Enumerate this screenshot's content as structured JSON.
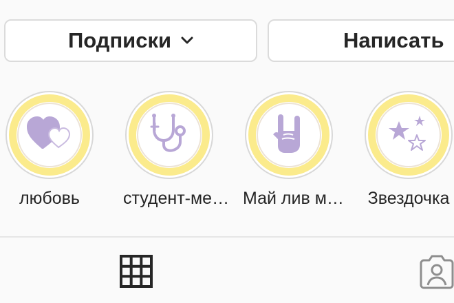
{
  "actions": {
    "follow_label": "Подписки",
    "message_label": "Написать"
  },
  "highlights": [
    {
      "label": "любовь",
      "icon": "hearts-icon"
    },
    {
      "label": "студент-ме…",
      "icon": "stethoscope-icon"
    },
    {
      "label": "Май лив м…",
      "icon": "rock-hand-icon"
    },
    {
      "label": "Звездочка",
      "icon": "stars-icon"
    }
  ],
  "tabs": [
    {
      "icon": "grid-icon"
    },
    {
      "icon": "tagged-person-icon"
    }
  ],
  "colors": {
    "ring_yellow": "#fbeb8c",
    "icon_lavender": "#b8a7d6",
    "text": "#262626",
    "background": "#fafafa"
  }
}
